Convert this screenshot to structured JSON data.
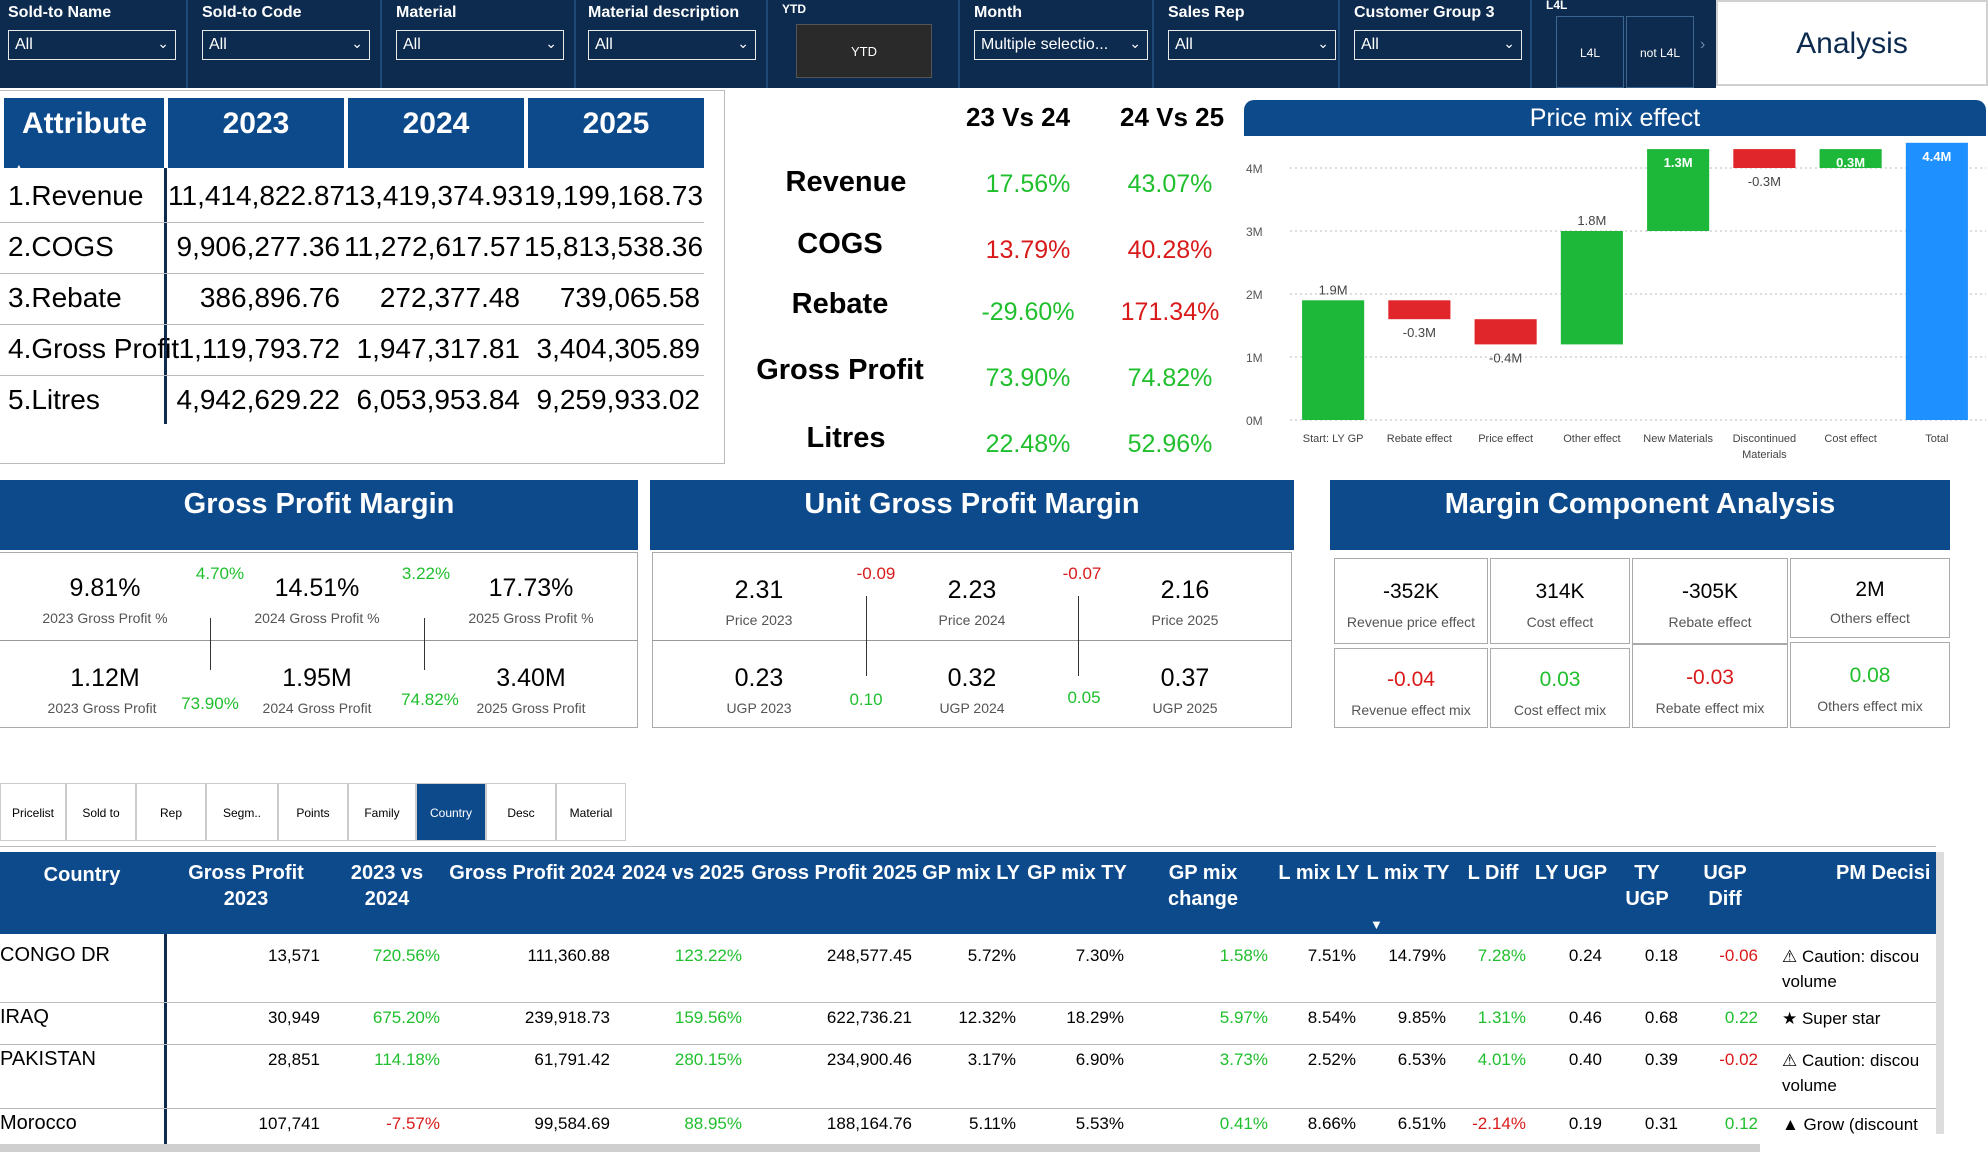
{
  "slicers": [
    {
      "label": "Sold-to Name",
      "value": "All"
    },
    {
      "label": "Sold-to Code",
      "value": "All"
    },
    {
      "label": "Material",
      "value": "All"
    },
    {
      "label": "Material description",
      "value": "All"
    },
    {
      "label": "YTD",
      "value": "YTD"
    },
    {
      "label": "Month",
      "value": "Multiple selectio..."
    },
    {
      "label": "Sales Rep",
      "value": "All"
    },
    {
      "label": "Customer Group 3",
      "value": "All"
    },
    {
      "label": "L4L",
      "options": [
        "L4L",
        "not L4L"
      ]
    }
  ],
  "analysis_button": "Analysis",
  "attribute_table": {
    "headers": [
      "Attribute",
      "2023",
      "2024",
      "2025"
    ],
    "rows": [
      {
        "label": "1.Revenue",
        "v2023": "11,414,822.87",
        "v2024": "13,419,374.93",
        "v2025": "19,199,168.73"
      },
      {
        "label": "2.COGS",
        "v2023": "9,906,277.36",
        "v2024": "11,272,617.57",
        "v2025": "15,813,538.36"
      },
      {
        "label": "3.Rebate",
        "v2023": "386,896.76",
        "v2024": "272,377.48",
        "v2025": "739,065.58"
      },
      {
        "label": "4.Gross Profit",
        "v2023": "1,119,793.72",
        "v2024": "1,947,317.81",
        "v2025": "3,404,305.89"
      },
      {
        "label": "5.Litres",
        "v2023": "4,942,629.22",
        "v2024": "6,053,953.84",
        "v2025": "9,259,933.02"
      }
    ]
  },
  "comparison": {
    "headers": [
      "23 Vs 24",
      "24 Vs 25"
    ],
    "rows": [
      {
        "metric": "Revenue",
        "a": "17.56%",
        "b": "43.07%",
        "a_color": "green",
        "b_color": "green"
      },
      {
        "metric": "COGS",
        "a": "13.79%",
        "b": "40.28%",
        "a_color": "red",
        "b_color": "red"
      },
      {
        "metric": "Rebate",
        "a": "-29.60%",
        "b": "171.34%",
        "a_color": "green",
        "b_color": "red"
      },
      {
        "metric": "Gross Profit",
        "a": "73.90%",
        "b": "74.82%",
        "a_color": "green",
        "b_color": "green"
      },
      {
        "metric": "Litres",
        "a": "22.48%",
        "b": "52.96%",
        "a_color": "green",
        "b_color": "green"
      }
    ]
  },
  "chart_data": {
    "type": "bar",
    "title": "Price mix effect",
    "categories": [
      "Start: LY GP",
      "Rebate effect",
      "Price effect",
      "Other effect",
      "New Materials",
      "Discontinued Materials",
      "Cost effect",
      "Total"
    ],
    "values": [
      1.9,
      -0.3,
      -0.4,
      1.8,
      1.3,
      -0.3,
      0.3,
      4.4
    ],
    "labels": [
      "1.9M",
      "-0.3M",
      "-0.4M",
      "1.8M",
      "1.3M",
      "-0.3M",
      "0.3M",
      "4.4M"
    ],
    "ylabel": "",
    "yticks": [
      "0M",
      "1M",
      "2M",
      "3M",
      "4M"
    ],
    "ylim": [
      0,
      4
    ],
    "grid": true,
    "colors": {
      "increase": "#1db83a",
      "decrease": "#e0262a",
      "total": "#1e90ff"
    }
  },
  "gpm": {
    "title": "Gross Profit Margin",
    "top": [
      {
        "value": "9.81%",
        "caption": "2023 Gross Profit %"
      },
      {
        "value": "14.51%",
        "caption": "2024 Gross Profit %"
      },
      {
        "value": "17.73%",
        "caption": "2025 Gross Profit %"
      }
    ],
    "top_deltas": [
      "4.70%",
      "3.22%"
    ],
    "bottom": [
      {
        "value": "1.12M",
        "caption": "2023 Gross Profit"
      },
      {
        "value": "1.95M",
        "caption": "2024 Gross Profit"
      },
      {
        "value": "3.40M",
        "caption": "2025 Gross Profit"
      }
    ],
    "bottom_deltas": [
      "73.90%",
      "74.82%"
    ]
  },
  "ugpm": {
    "title": "Unit Gross Profit Margin",
    "top": [
      {
        "value": "2.31",
        "caption": "Price 2023"
      },
      {
        "value": "2.23",
        "caption": "Price 2024"
      },
      {
        "value": "2.16",
        "caption": "Price 2025"
      }
    ],
    "top_deltas": [
      "-0.09",
      "-0.07"
    ],
    "bottom": [
      {
        "value": "0.23",
        "caption": "UGP 2023"
      },
      {
        "value": "0.32",
        "caption": "UGP 2024"
      },
      {
        "value": "0.37",
        "caption": "UGP 2025"
      }
    ],
    "bottom_deltas": [
      "0.10",
      "0.05"
    ]
  },
  "mca": {
    "title": "Margin Component Analysis",
    "top": [
      {
        "value": "-352K",
        "caption": "Revenue price effect"
      },
      {
        "value": "314K",
        "caption": "Cost effect"
      },
      {
        "value": "-305K",
        "caption": "Rebate effect"
      },
      {
        "value": "2M",
        "caption": "Others effect"
      }
    ],
    "bottom": [
      {
        "value": "-0.04",
        "caption": "Revenue effect mix",
        "color": "red"
      },
      {
        "value": "0.03",
        "caption": "Cost effect mix",
        "color": "green"
      },
      {
        "value": "-0.03",
        "caption": "Rebate effect mix",
        "color": "red"
      },
      {
        "value": "0.08",
        "caption": "Others effect mix",
        "color": "green"
      }
    ]
  },
  "tabs": [
    "Pricelist",
    "Sold to",
    "Rep",
    "Segm..",
    "Points",
    "Family",
    "Country",
    "Desc",
    "Material"
  ],
  "active_tab": "Country",
  "country_table": {
    "headers": [
      "Country",
      "Gross Profit 2023",
      "2023 vs 2024",
      "Gross Profit 2024",
      "2024 vs 2025",
      "Gross Profit 2025",
      "GP mix LY",
      "GP mix TY",
      "GP mix change",
      "L mix LY",
      "L mix TY",
      "L Diff",
      "LY UGP",
      "TY UGP",
      "UGP Diff",
      "PM Decisi"
    ],
    "rows": [
      {
        "country": "CONGO DR",
        "gp23": "13,571",
        "v2324": "720.56%",
        "gp24": "111,360.88",
        "v2425": "123.22%",
        "gp25": "248,577.45",
        "gpmly": "5.72%",
        "gpmty": "7.30%",
        "gpmch": "1.58%",
        "lmly": "7.51%",
        "lmty": "14.79%",
        "ldiff": "7.28%",
        "lyugp": "0.24",
        "tyugp": "0.18",
        "ugpdiff": "-0.06",
        "decision": "⚠ Caution: discou",
        "decision2": "volume"
      },
      {
        "country": "IRAQ",
        "gp23": "30,949",
        "v2324": "675.20%",
        "gp24": "239,918.73",
        "v2425": "159.56%",
        "gp25": "622,736.21",
        "gpmly": "12.32%",
        "gpmty": "18.29%",
        "gpmch": "5.97%",
        "lmly": "8.54%",
        "lmty": "9.85%",
        "ldiff": "1.31%",
        "lyugp": "0.46",
        "tyugp": "0.68",
        "ugpdiff": "0.22",
        "decision": "★ Super star",
        "decision2": ""
      },
      {
        "country": "PAKISTAN",
        "gp23": "28,851",
        "v2324": "114.18%",
        "gp24": "61,791.42",
        "v2425": "280.15%",
        "gp25": "234,900.46",
        "gpmly": "3.17%",
        "gpmty": "6.90%",
        "gpmch": "3.73%",
        "lmly": "2.52%",
        "lmty": "6.53%",
        "ldiff": "4.01%",
        "lyugp": "0.40",
        "tyugp": "0.39",
        "ugpdiff": "-0.02",
        "decision": "⚠ Caution: discou",
        "decision2": "volume"
      },
      {
        "country": "Morocco",
        "gp23": "107,741",
        "v2324": "-7.57%",
        "gp24": "99,584.69",
        "v2425": "88.95%",
        "gp25": "188,164.76",
        "gpmly": "5.11%",
        "gpmty": "5.53%",
        "gpmch": "0.41%",
        "lmly": "8.66%",
        "lmty": "6.51%",
        "ldiff": "-2.14%",
        "lyugp": "0.19",
        "tyugp": "0.31",
        "ugpdiff": "0.12",
        "decision": "▲ Grow (discount",
        "decision2": ""
      }
    ]
  }
}
